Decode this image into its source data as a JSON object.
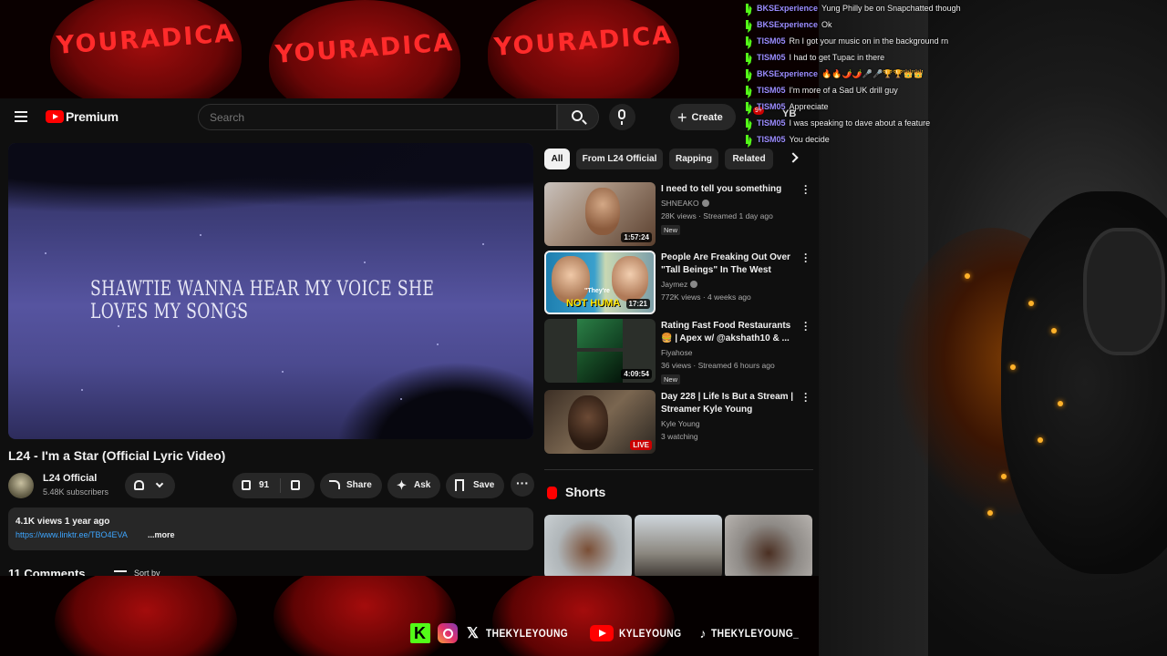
{
  "stream": {
    "cap_text": "YOURADICA",
    "socials": {
      "x_handle": "THEKYLEYOUNG",
      "youtube_handle": "KYLEYOUNG",
      "tiktok_handle": "THEKYLEYOUNG_"
    }
  },
  "chat": {
    "messages": [
      {
        "user": "BKSExperience",
        "color": "#9b8cff",
        "text": "Yung Philly be on Snapchatted though"
      },
      {
        "user": "BKSExperience",
        "color": "#9b8cff",
        "text": "Ok"
      },
      {
        "user": "TISM05",
        "color": "#9b8cff",
        "text": "Rn I got your music on in the background rn"
      },
      {
        "user": "TISM05",
        "color": "#9b8cff",
        "text": "I had to get Tupac in there"
      },
      {
        "user": "BKSExperience",
        "color": "#9b8cff",
        "text": "🔥🔥🌶️🌶️🎤🎤🏆🏆👑👑"
      },
      {
        "user": "TISM05",
        "color": "#9b8cff",
        "text": "I'm more of a Sad UK drill guy"
      },
      {
        "user": "TISM05",
        "color": "#9b8cff",
        "text": "Appreciate"
      },
      {
        "user": "TISM05",
        "color": "#9b8cff",
        "text": "I was speaking to dave about a feature"
      },
      {
        "user": "TISM05",
        "color": "#9b8cff",
        "text": "You decide"
      }
    ]
  },
  "youtube": {
    "brand": "Premium",
    "search_placeholder": "Search",
    "create_label": "Create",
    "notification_count": "9+",
    "avatar_initials": "YB",
    "player": {
      "lyric": "SHAWTIE WANNA HEAR MY VOICE SHE LOVES MY SONGS"
    },
    "video": {
      "title": "L24 - I'm a Star (Official Lyric Video)",
      "channel": "L24 Official",
      "subscribers": "5.48K subscribers",
      "likes": "91",
      "share_label": "Share",
      "ask_label": "Ask",
      "save_label": "Save",
      "more_label": "···"
    },
    "description": {
      "meta": "4.1K views  1 year ago",
      "link": "https://www.linktr.ee/TBO4EVA",
      "more": "...more"
    },
    "comments": {
      "count_label": "11 Comments",
      "sort_label": "Sort by"
    },
    "chips": [
      "All",
      "From L24 Official",
      "Rapping",
      "Related"
    ],
    "recommendations": [
      {
        "title": "I need to tell you something",
        "channel": "SHNEAKO",
        "verified": true,
        "meta": "28K views · Streamed 1 day ago",
        "badge": "New",
        "duration": "1:57:24",
        "live": false
      },
      {
        "title": "People Are Freaking Out Over \"Tall Beings\" In The West Coas...",
        "channel": "Jaymez",
        "verified": true,
        "meta": "772K views · 4 weeks ago",
        "badge": "",
        "duration": "17:21",
        "live": false
      },
      {
        "title": "Rating Fast Food Restaurants 🍔 | Apex w/ @akshath10 & ...",
        "channel": "Fiyahose",
        "verified": false,
        "meta": "36 views · Streamed 6 hours ago",
        "badge": "New",
        "duration": "4:09:54",
        "live": false
      },
      {
        "title": "Day 228 | Life Is But a Stream | Streamer Kyle Young",
        "channel": "Kyle Young",
        "verified": false,
        "meta": "3 watching",
        "badge": "",
        "duration": "LIVE",
        "live": true
      }
    ],
    "thumb_overlay_text": {
      "line1": "\"They're",
      "line2": "NOT HUMA"
    },
    "shorts_label": "Shorts"
  }
}
